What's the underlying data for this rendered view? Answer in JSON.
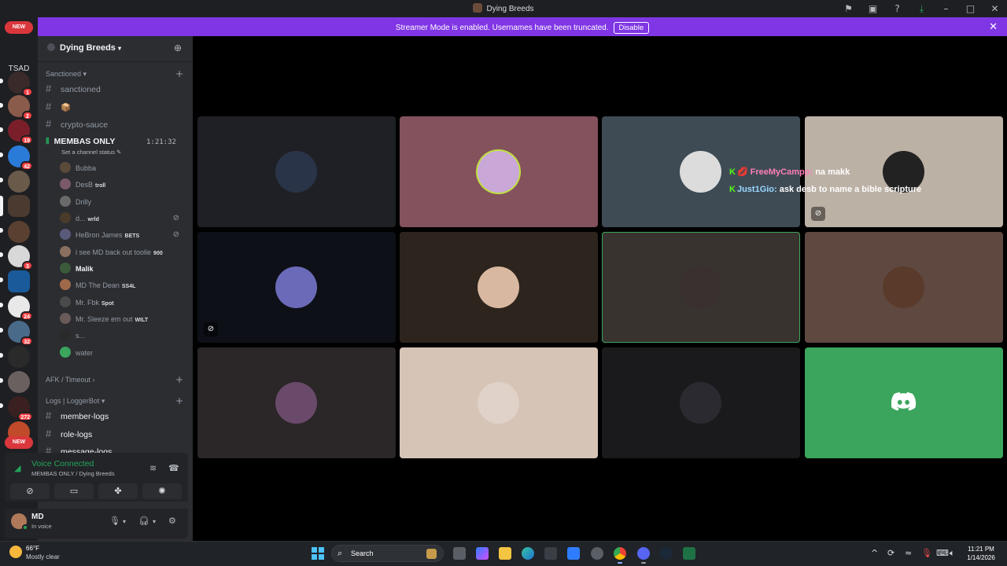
{
  "window": {
    "title": "Dying Breeds"
  },
  "banner": {
    "message": "Streamer Mode is enabled. Usernames have been truncated.",
    "button": "Disable"
  },
  "rail": {
    "new_top": "NEW",
    "new_bottom": "NEW",
    "tsad": "TSAD",
    "badges": [
      "1",
      "2",
      "19",
      "42",
      "3",
      "24",
      "32",
      "272"
    ]
  },
  "server": {
    "name": "Dying Breeds"
  },
  "categories": {
    "sanctioned": "Sanctioned",
    "afk": "AFK / Timeout",
    "logs": "Logs | LoggerBot"
  },
  "channels": {
    "sanctioned": "sanctioned",
    "box": "📦",
    "crypto": "crypto-sauce",
    "member_logs": "member-logs",
    "role_logs": "role-logs",
    "message_logs": "message-logs"
  },
  "voice_channel": {
    "name": "MEMBAS ONLY",
    "timer": "1:21:32",
    "status_hint": "Set a channel status"
  },
  "voice_users": [
    {
      "name": "Bubba",
      "tag": "",
      "color": "#5a4a3a"
    },
    {
      "name": "DesB",
      "tag": "troll",
      "color": "#7a5a6a"
    },
    {
      "name": "Drilly",
      "tag": "",
      "color": "#6a6a6a"
    },
    {
      "name": "d...",
      "tag": "wrld",
      "color": "#4a3a2a"
    },
    {
      "name": "HeBron James",
      "tag": "BETS",
      "color": "#5a5a7a"
    },
    {
      "name": "i see MD back out toolie",
      "tag": "900",
      "color": "#8a7060"
    },
    {
      "name": "Malik",
      "tag": "",
      "color": "#3a5a3a"
    },
    {
      "name": "MD The Dean",
      "tag": "SS4L",
      "color": "#a06a4a"
    },
    {
      "name": "Mr. Fbk",
      "tag": "Spot",
      "color": "#4a4a4a"
    },
    {
      "name": "Mr. Sleeze em out",
      "tag": "WILT",
      "color": "#6a5a5a"
    },
    {
      "name": "s...",
      "tag": "",
      "color": "#2a2a2a"
    },
    {
      "name": "water",
      "tag": "",
      "color": "#3ba55d"
    }
  ],
  "voice_panel": {
    "status": "Voice Connected",
    "location": "MEMBAS ONLY / Dying Breeds"
  },
  "user": {
    "name": "MD",
    "status": "In voice"
  },
  "chat_overlay": [
    {
      "name": "FreeMyCampp",
      "message": "na makk"
    },
    {
      "name": "Just1Gio",
      "message": "ask desb to name a bible scripture"
    }
  ],
  "taskbar": {
    "temp": "66°F",
    "weather": "Mostly clear",
    "search": "Search",
    "time": "11:21 PM",
    "date": "1/14/2026"
  },
  "colors": {
    "accent": "#8036e4",
    "online": "#23a55a",
    "discord_green": "#3ba55d"
  }
}
